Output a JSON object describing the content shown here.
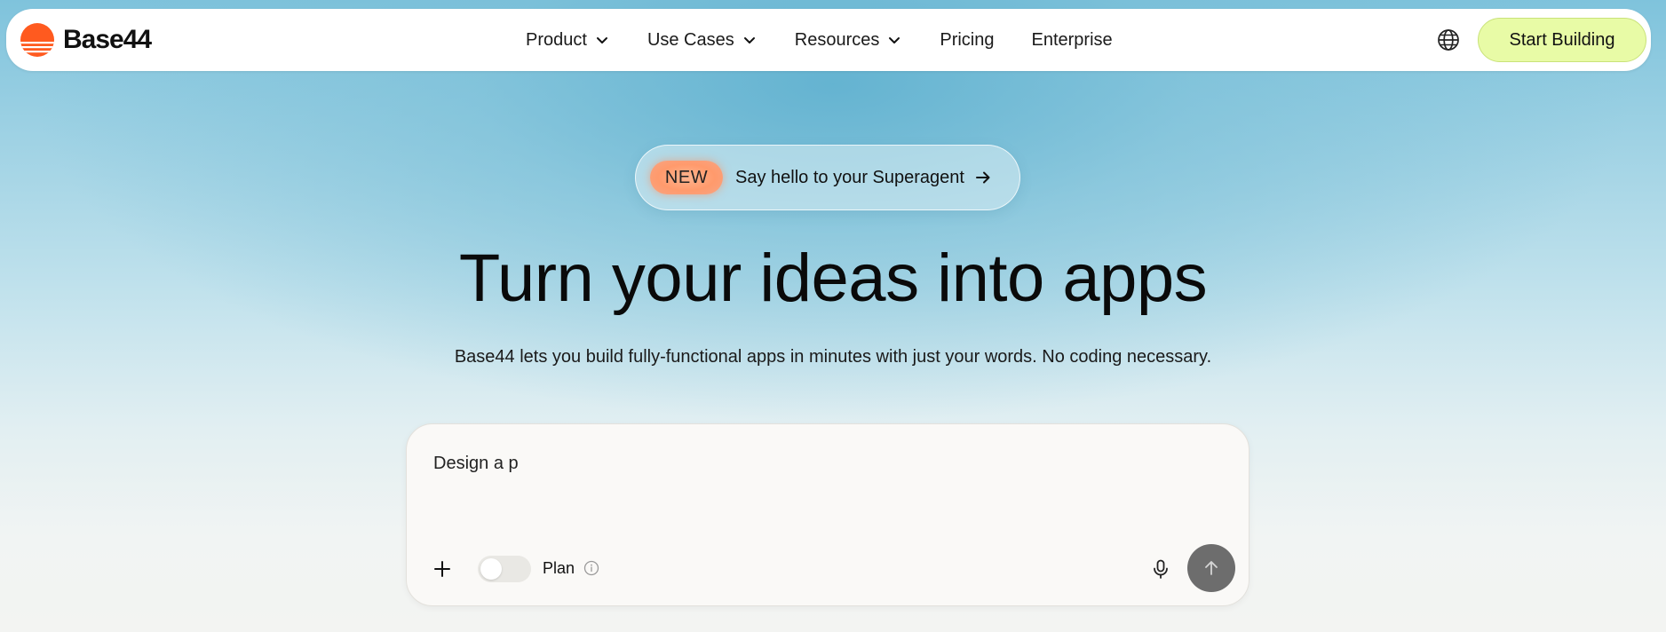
{
  "brand": {
    "name": "Base44",
    "accent_color": "#ff5a1f"
  },
  "nav": {
    "items": [
      {
        "label": "Product",
        "has_dropdown": true
      },
      {
        "label": "Use Cases",
        "has_dropdown": true
      },
      {
        "label": "Resources",
        "has_dropdown": true
      },
      {
        "label": "Pricing",
        "has_dropdown": false
      },
      {
        "label": "Enterprise",
        "has_dropdown": false
      }
    ],
    "language_icon": "globe-icon",
    "cta_label": "Start Building",
    "cta_color": "#e8fba6"
  },
  "hero": {
    "badge_tag": "NEW",
    "badge_text": "Say hello to your Superagent",
    "title": "Turn your ideas into apps",
    "subtitle": "Base44 lets you build fully-functional apps in minutes with just your words. No coding necessary."
  },
  "prompt": {
    "value": "Design a p",
    "plan_label": "Plan",
    "plan_enabled": false
  }
}
